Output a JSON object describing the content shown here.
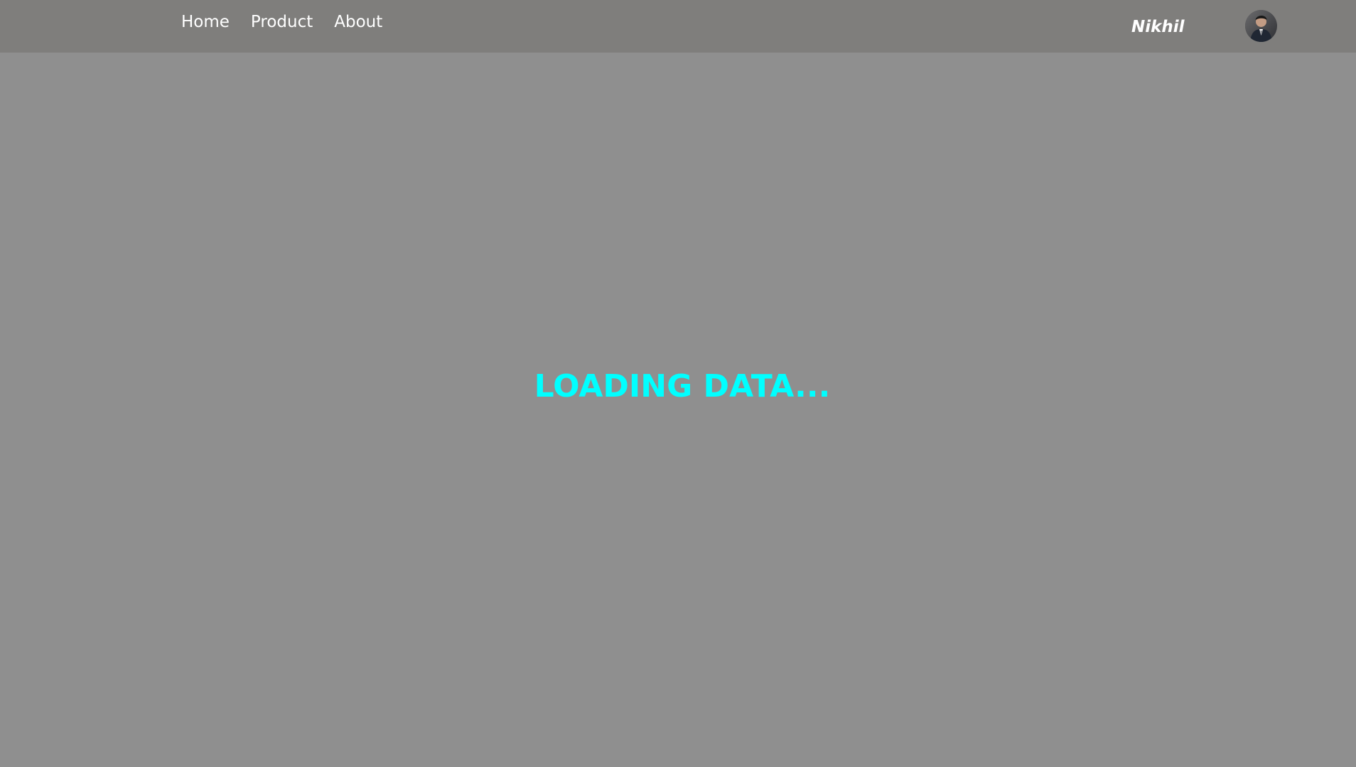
{
  "navbar": {
    "links": [
      {
        "label": "Home"
      },
      {
        "label": "Product"
      },
      {
        "label": "About"
      }
    ],
    "user": {
      "name": "Nikhil",
      "avatar_icon": "user-photo-avatar"
    }
  },
  "main": {
    "loading_text": "LOADING DATA..."
  },
  "colors": {
    "navbar_background": "#7f7e7c",
    "page_background": "#8f8f8f",
    "nav_text": "#ffffff",
    "loading_text": "#00ffff"
  }
}
